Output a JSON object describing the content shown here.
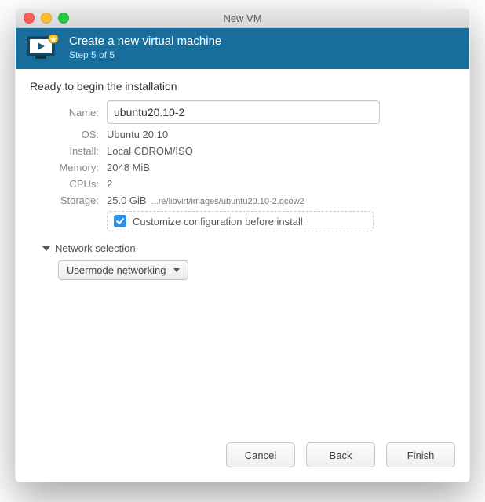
{
  "window": {
    "title": "New VM"
  },
  "header": {
    "title": "Create a new virtual machine",
    "step": "Step 5 of 5"
  },
  "intro": "Ready to begin the installation",
  "labels": {
    "name": "Name:",
    "os": "OS:",
    "install": "Install:",
    "memory": "Memory:",
    "cpus": "CPUs:",
    "storage": "Storage:"
  },
  "values": {
    "name": "ubuntu20.10-2",
    "os": "Ubuntu 20.10",
    "install": "Local CDROM/ISO",
    "memory": "2048 MiB",
    "cpus": "2",
    "storage_size": "25.0 GiB",
    "storage_path": "...re/libvirt/images/ubuntu20.10-2.qcow2"
  },
  "customize": {
    "checked": true,
    "label": "Customize configuration before install"
  },
  "network": {
    "header": "Network selection",
    "value": "Usermode networking"
  },
  "buttons": {
    "cancel": "Cancel",
    "back": "Back",
    "finish": "Finish"
  }
}
